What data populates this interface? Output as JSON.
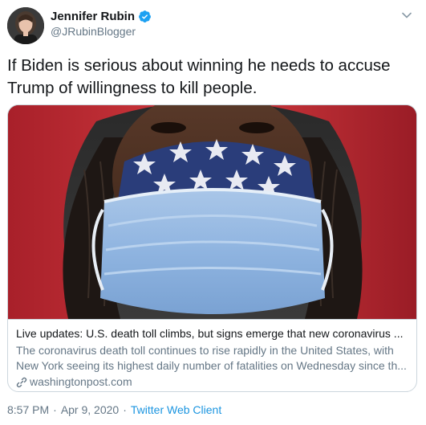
{
  "author": {
    "display_name": "Jennifer Rubin",
    "handle": "@JRubinBlogger",
    "verified": true
  },
  "tweet": {
    "text_line1": "If Biden is serious about winning he needs to accuse",
    "text_line2": "Trump of willingness to kill people."
  },
  "card": {
    "title": "Live updates: U.S. death toll climbs, but signs emerge that new coronavirus ...",
    "description_line1": "The coronavirus death toll continues to rise rapidly in the United States, with",
    "description_line2": "New York seeing its highest daily number of fatalities on Wednesday since th...",
    "domain": "washingtonpost.com",
    "image_icon": "photo-masked-face"
  },
  "meta": {
    "time": "8:57 PM",
    "separator1": "·",
    "date": "Apr 9, 2020",
    "separator2": "·",
    "client": "Twitter Web Client"
  },
  "colors": {
    "verified": "#1da1f2",
    "link": "#1b95e0",
    "secondary_text": "#657786",
    "primary_text": "#14171a",
    "border": "#ccd6dd"
  },
  "icons": {
    "verified": "verified-badge-icon",
    "caret": "chevron-down-icon",
    "link": "link-icon"
  }
}
